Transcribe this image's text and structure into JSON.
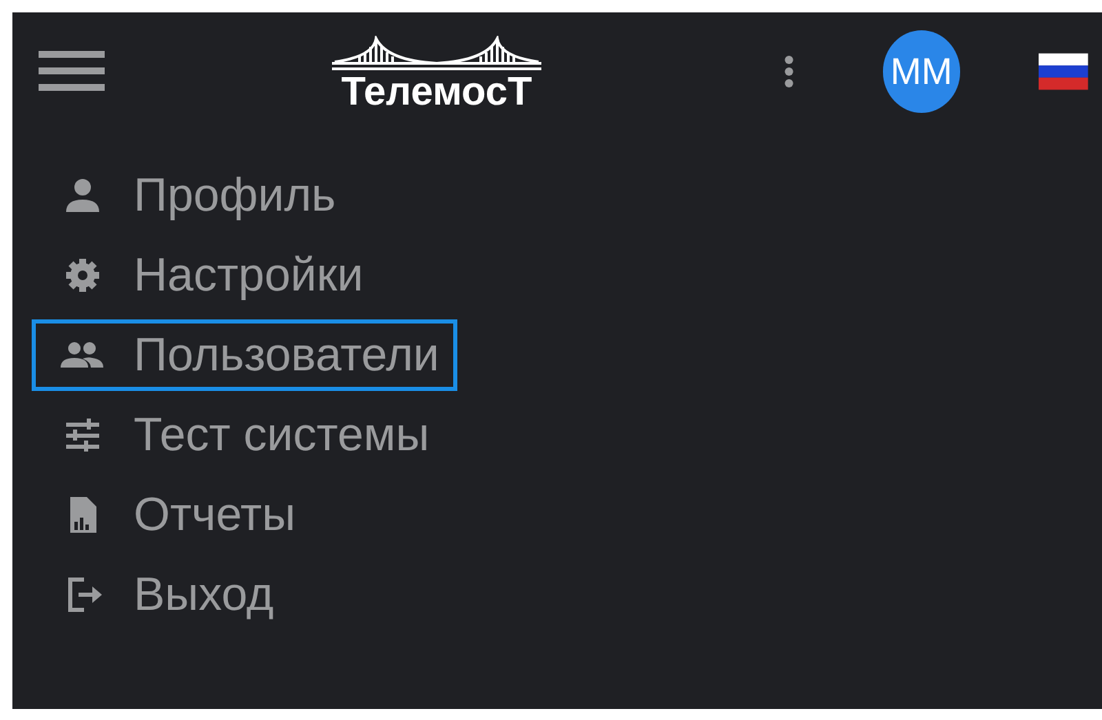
{
  "header": {
    "logo_text": "ТелемосТ",
    "avatar_initials": "MM"
  },
  "menu": [
    {
      "label": "Профиль",
      "kind": "profile",
      "selected": false
    },
    {
      "label": "Настройки",
      "kind": "settings",
      "selected": false
    },
    {
      "label": "Пользователи",
      "kind": "users",
      "selected": true
    },
    {
      "label": "Тест системы",
      "kind": "test",
      "selected": false
    },
    {
      "label": "Отчеты",
      "kind": "reports",
      "selected": false
    },
    {
      "label": "Выход",
      "kind": "logout",
      "selected": false
    }
  ]
}
